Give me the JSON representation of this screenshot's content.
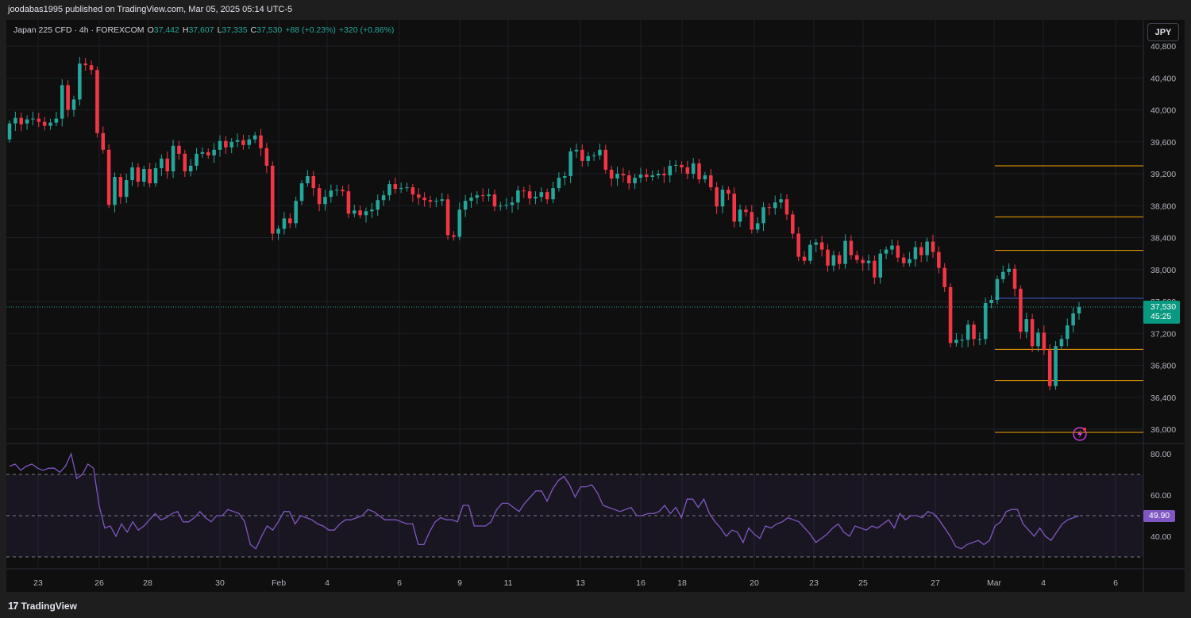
{
  "publisher_line": "joodabas1995 published on TradingView.com, Mar 05, 2025 05:14 UTC-5",
  "symbol": {
    "title": "Japan 225 CFD · 4h · FOREXCOM",
    "open_label": "O",
    "open": "37,442",
    "high_label": "H",
    "high": "37,607",
    "low_label": "L",
    "low": "37,335",
    "close_label": "C",
    "close": "37,530",
    "change": "+88 (+0.23%)",
    "change2": "+320 (+0.86%)"
  },
  "currency_button": "JPY",
  "price_tag": {
    "price": "37,530",
    "countdown": "45:25"
  },
  "rsi_tag": "49.90",
  "brand": {
    "name": "TradingView"
  },
  "colors": {
    "up": "#26a69a",
    "down": "#f23645",
    "background": "#0f0f0f",
    "level_line": "#f7a600",
    "rsi_line": "#7e57c2",
    "price_line_blue": "#3f5fd1"
  },
  "icons": [
    "tradingview-logo-icon",
    "lightning-alert-icon"
  ],
  "chart_data": {
    "type": "candlestick",
    "timeframe": "4h",
    "price_axis": {
      "ticks": [
        "40,800",
        "40,400",
        "40,000",
        "39,600",
        "39,200",
        "38,800",
        "38,400",
        "38,000",
        "37,600",
        "37,200",
        "36,800",
        "36,400",
        "36,000"
      ],
      "tick_values": [
        40800,
        40400,
        40000,
        39600,
        39200,
        38800,
        38400,
        38000,
        37600,
        37200,
        36800,
        36400,
        36000
      ]
    },
    "time_axis": {
      "labels": [
        "23",
        "26",
        "28",
        "30",
        "Feb",
        "4",
        "6",
        "9",
        "11",
        "13",
        "16",
        "18",
        "20",
        "23",
        "25",
        "27",
        "Mar",
        "4",
        "6"
      ]
    },
    "horizontal_levels": [
      39300,
      38660,
      38240,
      37000,
      36610,
      35960
    ],
    "blue_level": 37640,
    "last_price": 37530,
    "candles": [
      {
        "o": 39630,
        "c": 39830
      },
      {
        "o": 39830,
        "c": 39900
      },
      {
        "o": 39900,
        "c": 39820
      },
      {
        "o": 39830,
        "c": 39880
      },
      {
        "o": 39880,
        "c": 39890
      },
      {
        "o": 39890,
        "c": 39850
      },
      {
        "o": 39850,
        "c": 39800
      },
      {
        "o": 39800,
        "c": 39840
      },
      {
        "o": 39840,
        "c": 39890
      },
      {
        "o": 39890,
        "c": 40310
      },
      {
        "o": 40310,
        "c": 40000
      },
      {
        "o": 40000,
        "c": 40130
      },
      {
        "o": 40130,
        "c": 40580
      },
      {
        "o": 40580,
        "c": 40560
      },
      {
        "o": 40560,
        "c": 40500
      },
      {
        "o": 40500,
        "c": 39710
      },
      {
        "o": 39710,
        "c": 39500
      },
      {
        "o": 39500,
        "c": 38810
      },
      {
        "o": 38810,
        "c": 39160
      },
      {
        "o": 39160,
        "c": 38910
      },
      {
        "o": 38910,
        "c": 39120
      },
      {
        "o": 39120,
        "c": 39280
      },
      {
        "o": 39280,
        "c": 39100
      },
      {
        "o": 39100,
        "c": 39260
      },
      {
        "o": 39260,
        "c": 39080
      },
      {
        "o": 39080,
        "c": 39270
      },
      {
        "o": 39270,
        "c": 39390
      },
      {
        "o": 39390,
        "c": 39230
      },
      {
        "o": 39230,
        "c": 39550
      },
      {
        "o": 39550,
        "c": 39450
      },
      {
        "o": 39450,
        "c": 39230
      },
      {
        "o": 39230,
        "c": 39300
      },
      {
        "o": 39300,
        "c": 39450
      },
      {
        "o": 39450,
        "c": 39470
      },
      {
        "o": 39470,
        "c": 39430
      },
      {
        "o": 39430,
        "c": 39500
      },
      {
        "o": 39500,
        "c": 39610
      },
      {
        "o": 39610,
        "c": 39530
      },
      {
        "o": 39530,
        "c": 39600
      },
      {
        "o": 39600,
        "c": 39620
      },
      {
        "o": 39620,
        "c": 39560
      },
      {
        "o": 39560,
        "c": 39630
      },
      {
        "o": 39630,
        "c": 39680
      },
      {
        "o": 39680,
        "c": 39520
      },
      {
        "o": 39520,
        "c": 39300
      },
      {
        "o": 39300,
        "c": 38450
      },
      {
        "o": 38450,
        "c": 38510
      },
      {
        "o": 38510,
        "c": 38640
      },
      {
        "o": 38640,
        "c": 38580
      },
      {
        "o": 38580,
        "c": 38860
      },
      {
        "o": 38860,
        "c": 39080
      },
      {
        "o": 39080,
        "c": 39170
      },
      {
        "o": 39170,
        "c": 39020
      },
      {
        "o": 39020,
        "c": 38820
      },
      {
        "o": 38820,
        "c": 38910
      },
      {
        "o": 38910,
        "c": 38990
      },
      {
        "o": 38990,
        "c": 39000
      },
      {
        "o": 39000,
        "c": 38980
      },
      {
        "o": 38980,
        "c": 38700
      },
      {
        "o": 38700,
        "c": 38740
      },
      {
        "o": 38740,
        "c": 38680
      },
      {
        "o": 38680,
        "c": 38730
      },
      {
        "o": 38730,
        "c": 38750
      },
      {
        "o": 38750,
        "c": 38870
      },
      {
        "o": 38870,
        "c": 38930
      },
      {
        "o": 38930,
        "c": 39070
      },
      {
        "o": 39070,
        "c": 39010
      },
      {
        "o": 39010,
        "c": 39020
      },
      {
        "o": 39020,
        "c": 39030
      },
      {
        "o": 39030,
        "c": 38940
      },
      {
        "o": 38940,
        "c": 38900
      },
      {
        "o": 38900,
        "c": 38870
      },
      {
        "o": 38870,
        "c": 38850
      },
      {
        "o": 38850,
        "c": 38860
      },
      {
        "o": 38860,
        "c": 38880
      },
      {
        "o": 38880,
        "c": 38430
      },
      {
        "o": 38430,
        "c": 38410
      },
      {
        "o": 38410,
        "c": 38750
      },
      {
        "o": 38750,
        "c": 38860
      },
      {
        "o": 38860,
        "c": 38900
      },
      {
        "o": 38900,
        "c": 38930
      },
      {
        "o": 38930,
        "c": 38920
      },
      {
        "o": 38920,
        "c": 38940
      },
      {
        "o": 38940,
        "c": 38790
      },
      {
        "o": 38790,
        "c": 38800
      },
      {
        "o": 38800,
        "c": 38810
      },
      {
        "o": 38810,
        "c": 38840
      },
      {
        "o": 38840,
        "c": 38990
      },
      {
        "o": 38990,
        "c": 38980
      },
      {
        "o": 38980,
        "c": 38890
      },
      {
        "o": 38890,
        "c": 38910
      },
      {
        "o": 38910,
        "c": 38970
      },
      {
        "o": 38970,
        "c": 38880
      },
      {
        "o": 38880,
        "c": 39020
      },
      {
        "o": 39020,
        "c": 39150
      },
      {
        "o": 39150,
        "c": 39170
      },
      {
        "o": 39170,
        "c": 39480
      },
      {
        "o": 39480,
        "c": 39500
      },
      {
        "o": 39500,
        "c": 39360
      },
      {
        "o": 39360,
        "c": 39420
      },
      {
        "o": 39420,
        "c": 39430
      },
      {
        "o": 39430,
        "c": 39500
      },
      {
        "o": 39500,
        "c": 39250
      },
      {
        "o": 39250,
        "c": 39140
      },
      {
        "o": 39140,
        "c": 39200
      },
      {
        "o": 39200,
        "c": 39180
      },
      {
        "o": 39180,
        "c": 39080
      },
      {
        "o": 39080,
        "c": 39150
      },
      {
        "o": 39150,
        "c": 39190
      },
      {
        "o": 39190,
        "c": 39160
      },
      {
        "o": 39160,
        "c": 39180
      },
      {
        "o": 39180,
        "c": 39200
      },
      {
        "o": 39200,
        "c": 39180
      },
      {
        "o": 39180,
        "c": 39300
      },
      {
        "o": 39300,
        "c": 39310
      },
      {
        "o": 39310,
        "c": 39280
      },
      {
        "o": 39280,
        "c": 39200
      },
      {
        "o": 39200,
        "c": 39330
      },
      {
        "o": 39330,
        "c": 39130
      },
      {
        "o": 39130,
        "c": 39180
      },
      {
        "o": 39180,
        "c": 39030
      },
      {
        "o": 39030,
        "c": 38790
      },
      {
        "o": 38790,
        "c": 39000
      },
      {
        "o": 39000,
        "c": 38950
      },
      {
        "o": 38950,
        "c": 38600
      },
      {
        "o": 38600,
        "c": 38750
      },
      {
        "o": 38750,
        "c": 38720
      },
      {
        "o": 38720,
        "c": 38500
      },
      {
        "o": 38500,
        "c": 38580
      },
      {
        "o": 38580,
        "c": 38780
      },
      {
        "o": 38780,
        "c": 38770
      },
      {
        "o": 38770,
        "c": 38840
      },
      {
        "o": 38840,
        "c": 38880
      },
      {
        "o": 38880,
        "c": 38690
      },
      {
        "o": 38690,
        "c": 38450
      },
      {
        "o": 38450,
        "c": 38160
      },
      {
        "o": 38160,
        "c": 38110
      },
      {
        "o": 38110,
        "c": 38310
      },
      {
        "o": 38310,
        "c": 38340
      },
      {
        "o": 38340,
        "c": 38250
      },
      {
        "o": 38250,
        "c": 38050
      },
      {
        "o": 38050,
        "c": 38180
      },
      {
        "o": 38180,
        "c": 38070
      },
      {
        "o": 38070,
        "c": 38360
      },
      {
        "o": 38360,
        "c": 38180
      },
      {
        "o": 38180,
        "c": 38120
      },
      {
        "o": 38120,
        "c": 38080
      },
      {
        "o": 38080,
        "c": 38110
      },
      {
        "o": 38110,
        "c": 37900
      },
      {
        "o": 37900,
        "c": 38200
      },
      {
        "o": 38200,
        "c": 38250
      },
      {
        "o": 38250,
        "c": 38300
      },
      {
        "o": 38300,
        "c": 38150
      },
      {
        "o": 38150,
        "c": 38080
      },
      {
        "o": 38080,
        "c": 38130
      },
      {
        "o": 38130,
        "c": 38280
      },
      {
        "o": 38280,
        "c": 38180
      },
      {
        "o": 38180,
        "c": 38350
      },
      {
        "o": 38350,
        "c": 38220
      },
      {
        "o": 38220,
        "c": 38020
      },
      {
        "o": 38020,
        "c": 37780
      },
      {
        "o": 37780,
        "c": 37080
      },
      {
        "o": 37080,
        "c": 37120
      },
      {
        "o": 37120,
        "c": 37120
      },
      {
        "o": 37120,
        "c": 37310
      },
      {
        "o": 37310,
        "c": 37130
      },
      {
        "o": 37130,
        "c": 37130
      },
      {
        "o": 37130,
        "c": 37580
      },
      {
        "o": 37580,
        "c": 37620
      },
      {
        "o": 37620,
        "c": 37880
      },
      {
        "o": 37880,
        "c": 37970
      },
      {
        "o": 37970,
        "c": 38010
      },
      {
        "o": 38010,
        "c": 37760
      },
      {
        "o": 37760,
        "c": 37220
      },
      {
        "o": 37220,
        "c": 37380
      },
      {
        "o": 37380,
        "c": 37040
      },
      {
        "o": 37040,
        "c": 37210
      },
      {
        "o": 37210,
        "c": 36990
      },
      {
        "o": 36990,
        "c": 36540
      },
      {
        "o": 36540,
        "c": 37040
      },
      {
        "o": 37040,
        "c": 37130
      },
      {
        "o": 37130,
        "c": 37300
      },
      {
        "o": 37300,
        "c": 37450
      },
      {
        "o": 37450,
        "c": 37530
      }
    ],
    "rsi": {
      "name": "RSI",
      "ticks": [
        "80.00",
        "60.00",
        "40.00"
      ],
      "tick_values": [
        80,
        60,
        40
      ],
      "upper_band": 70,
      "lower_band": 30,
      "middle": 50,
      "last": 49.9,
      "values": [
        74,
        75,
        72,
        74,
        75,
        73,
        72,
        73,
        73,
        71,
        74,
        80,
        68,
        70,
        75,
        73,
        55,
        44,
        45,
        40,
        46,
        42,
        47,
        43,
        45,
        48,
        51,
        48,
        49,
        51,
        52,
        47,
        47,
        49,
        52,
        49,
        47,
        50,
        50,
        53,
        52,
        51,
        47,
        36,
        34,
        40,
        45,
        43,
        47,
        52,
        52,
        46,
        50,
        49,
        48,
        46,
        45,
        43,
        43,
        46,
        48,
        48,
        49,
        50,
        53,
        52,
        50,
        48,
        48,
        48,
        47,
        46,
        46,
        36,
        36,
        42,
        47,
        49,
        48,
        48,
        47,
        55,
        55,
        45,
        45,
        45,
        47,
        53,
        56,
        56,
        54,
        52,
        56,
        59,
        62,
        62,
        57,
        63,
        67,
        69,
        65,
        59,
        64,
        64,
        65,
        61,
        55,
        54,
        53,
        52,
        53,
        54,
        50,
        50,
        51,
        51,
        52,
        55,
        51,
        54,
        49,
        58,
        58,
        54,
        58,
        51,
        47,
        44,
        40,
        43,
        42,
        37,
        44,
        41,
        39,
        45,
        44,
        46,
        47,
        49,
        48,
        47,
        44,
        41,
        37,
        39,
        41,
        44,
        46,
        42,
        40,
        45,
        44,
        43,
        45,
        44,
        46,
        48,
        44,
        51,
        48,
        50,
        50,
        49,
        52,
        51,
        48,
        44,
        40,
        35,
        34,
        36,
        37,
        38,
        36,
        38,
        45,
        47,
        52,
        53,
        53,
        46,
        43,
        40,
        44,
        40,
        38,
        42,
        46,
        48,
        49,
        50
      ]
    }
  }
}
